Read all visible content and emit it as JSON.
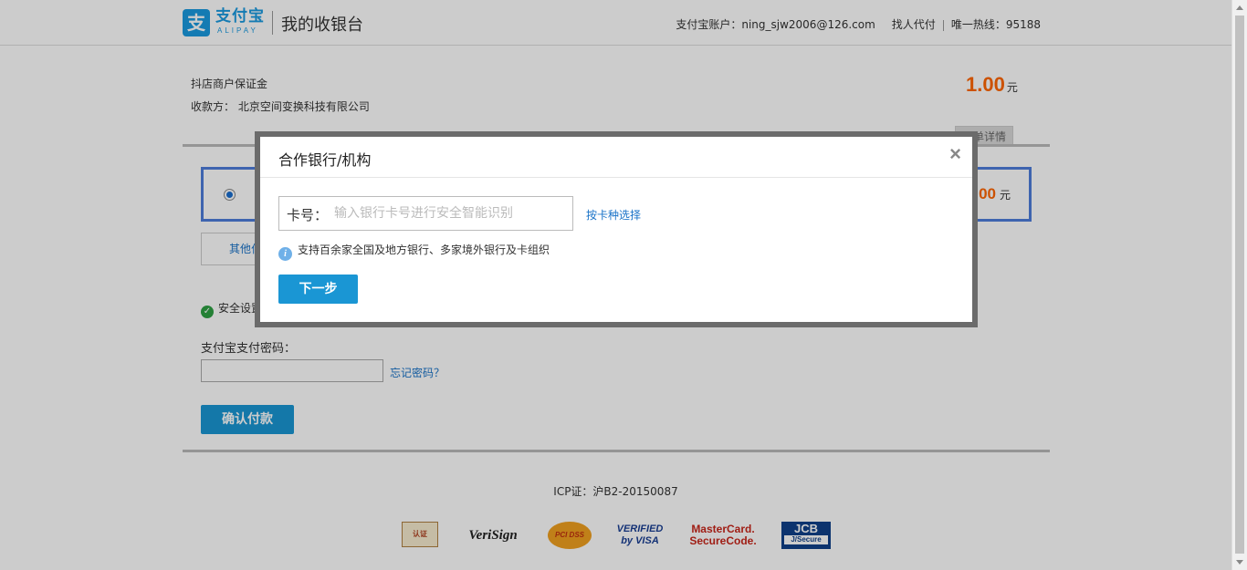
{
  "header": {
    "logo_mark": "支",
    "logo_text": "支付宝",
    "logo_sub": "ALIPAY",
    "title": "我的收银台",
    "account_label": "支付宝账户：",
    "account": "ning_sjw2006@126.com",
    "find_payer": "找人代付",
    "hotline": "唯一热线：95188"
  },
  "order": {
    "name": "抖店商户保证金",
    "payee_label": "收款方：",
    "payee": "北京空间变换科技有限公司",
    "amount": "1.00",
    "currency": "元",
    "detail_tab": "订单详情"
  },
  "payment": {
    "method_amount": "1.00",
    "method_currency": "元",
    "other_methods": "其他付款方式",
    "security_text": "安全设置",
    "password_label": "支付宝支付密码：",
    "forgot_password": "忘记密码？",
    "confirm_button": "确认付款"
  },
  "modal": {
    "title": "合作银行/机构",
    "close": "×",
    "card_label": "卡号：",
    "card_placeholder": "输入银行卡号进行安全智能识别",
    "card_value": "",
    "by_card_type": "按卡种选择",
    "info_icon": "i",
    "info_text": "支持百余家全国及地方银行、多家境外银行及卡组织",
    "next_button": "下一步"
  },
  "footer": {
    "icp": "ICP证：沪B2-20150087",
    "badges": {
      "cert": "认证",
      "verisign": "VeriSign",
      "pcidss": "PCI DSS",
      "visa_line1": "VERIFIED",
      "visa_line2": "by VISA",
      "mc_line1": "MasterCard.",
      "mc_line2": "SecureCode.",
      "jcb_line1": "JCB",
      "jcb_line2": "J/Secure"
    }
  },
  "icons": {
    "check": "check-icon",
    "info": "info-icon",
    "close": "close-icon"
  },
  "colors": {
    "brand_blue": "#1a9ae0",
    "button_blue": "#1a96d4",
    "amount_orange": "#ff6600",
    "link_blue": "#1a73c8"
  }
}
